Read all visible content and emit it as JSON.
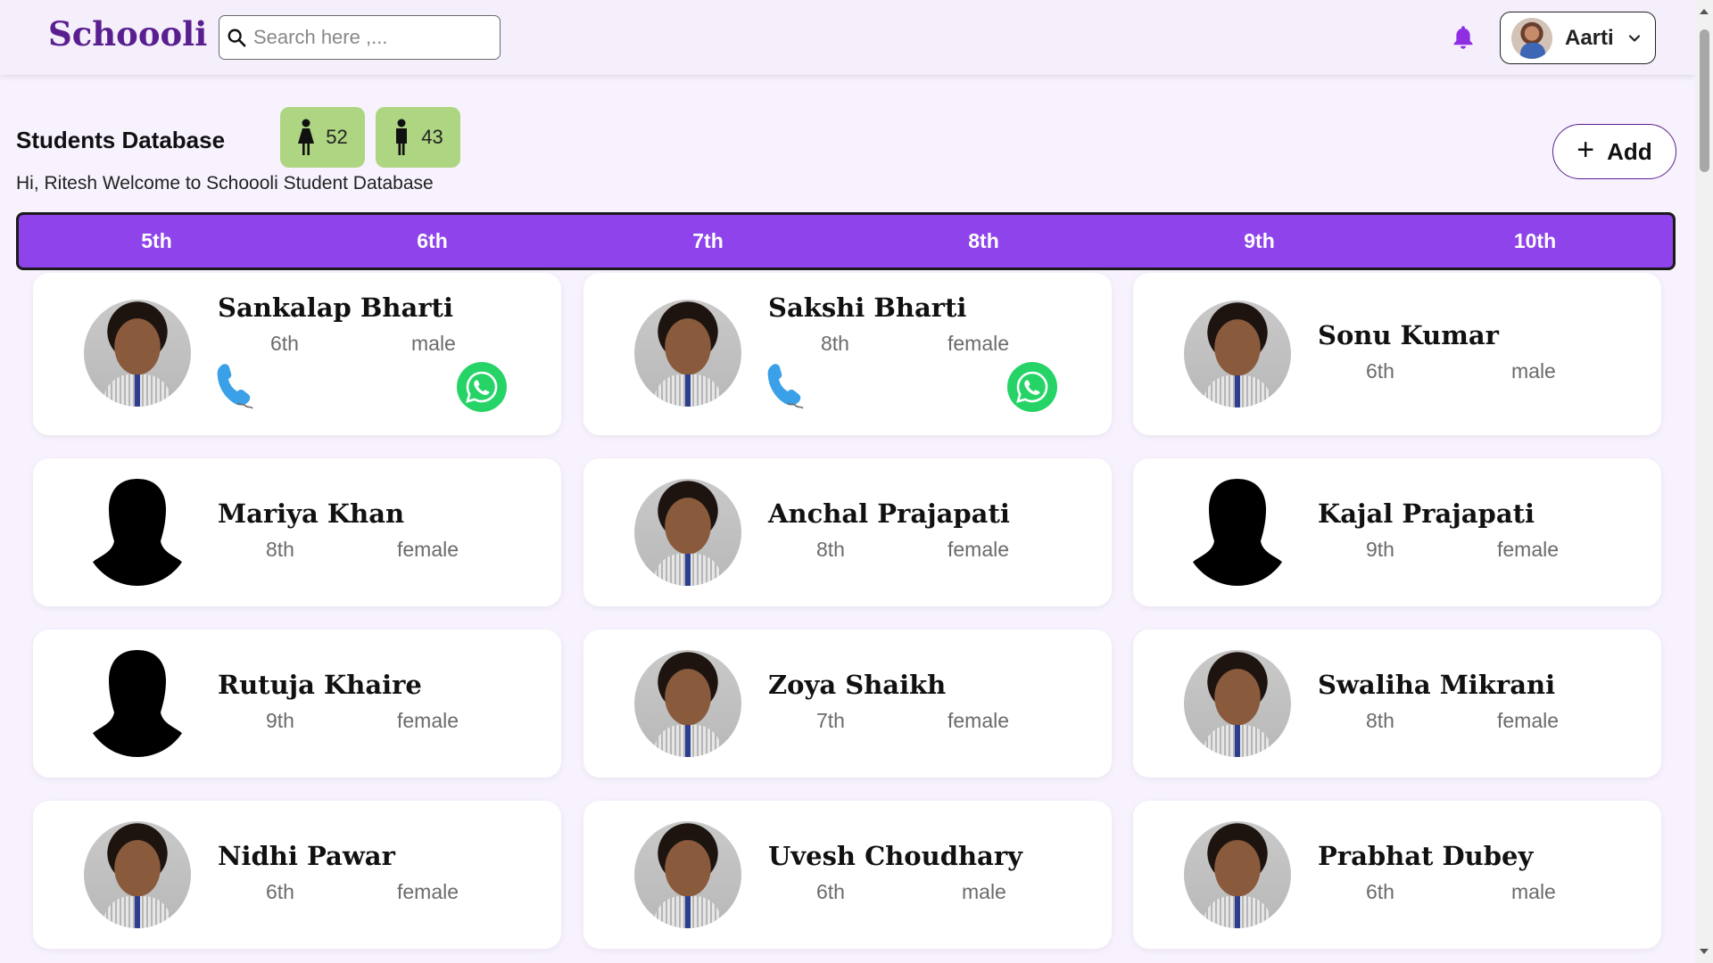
{
  "navbar": {
    "logo": "Schoooli",
    "search_placeholder": "Search here ,...",
    "user_name": "Aarti"
  },
  "header": {
    "title": "Students Database",
    "female_count": "52",
    "male_count": "43",
    "welcome": "Hi, Ritesh Welcome to Schoooli Student Database",
    "add_label": "Add"
  },
  "tabs": [
    "5th",
    "6th",
    "7th",
    "8th",
    "9th",
    "10th"
  ],
  "colors": {
    "brand": "#5a1f8f",
    "tab_bar": "#8e44ea",
    "count_badge": "#aed581",
    "bell": "#8e2de2",
    "whatsapp": "#25d366"
  },
  "students": [
    {
      "name": "Sankalap Bharti",
      "class": "6th",
      "gender": "male",
      "avatar": "photo",
      "contacts": true
    },
    {
      "name": "Sakshi Bharti",
      "class": "8th",
      "gender": "female",
      "avatar": "photo",
      "contacts": true
    },
    {
      "name": "Sonu Kumar",
      "class": "6th",
      "gender": "male",
      "avatar": "photo",
      "contacts": false
    },
    {
      "name": "Mariya Khan",
      "class": "8th",
      "gender": "female",
      "avatar": "silhouette",
      "contacts": false
    },
    {
      "name": "Anchal Prajapati",
      "class": "8th",
      "gender": "female",
      "avatar": "photo",
      "contacts": false
    },
    {
      "name": "Kajal Prajapati",
      "class": "9th",
      "gender": "female",
      "avatar": "silhouette",
      "contacts": false
    },
    {
      "name": "Rutuja Khaire",
      "class": "9th",
      "gender": "female",
      "avatar": "silhouette",
      "contacts": false
    },
    {
      "name": "Zoya Shaikh",
      "class": "7th",
      "gender": "female",
      "avatar": "photo",
      "contacts": false
    },
    {
      "name": "Swaliha Mikrani",
      "class": "8th",
      "gender": "female",
      "avatar": "photo",
      "contacts": false
    },
    {
      "name": "Nidhi Pawar",
      "class": "6th",
      "gender": "female",
      "avatar": "photo",
      "contacts": false
    },
    {
      "name": "Uvesh Choudhary",
      "class": "6th",
      "gender": "male",
      "avatar": "photo",
      "contacts": false
    },
    {
      "name": "Prabhat Dubey",
      "class": "6th",
      "gender": "male",
      "avatar": "photo",
      "contacts": false
    }
  ]
}
